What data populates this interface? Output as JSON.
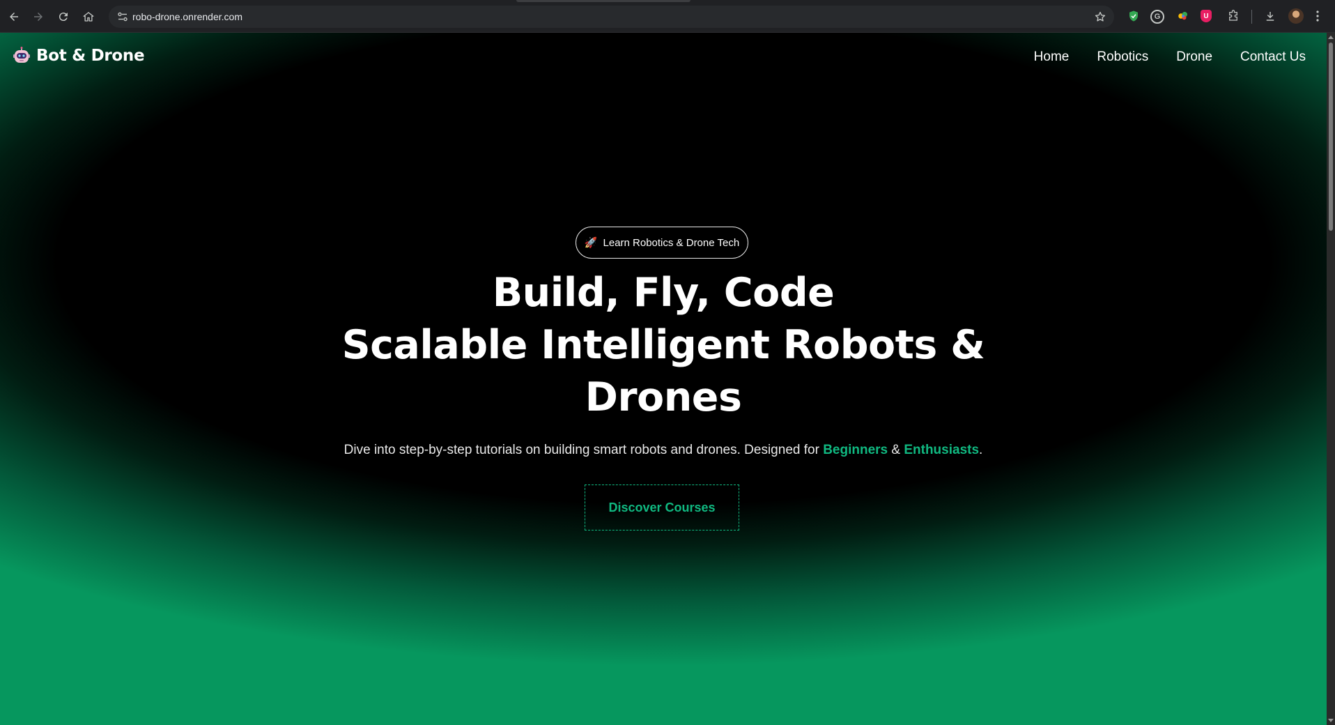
{
  "browser": {
    "url": "robo-drone.onrender.com",
    "nav": {
      "back_icon": "arrow-left-icon",
      "forward_icon": "arrow-right-icon",
      "reload_icon": "reload-icon",
      "home_icon": "home-icon"
    },
    "extensions": [
      "shield-extension-icon",
      "grammarly-extension-icon",
      "colorful-extension-icon",
      "ublock-extension-icon",
      "puzzle-extensions-icon"
    ],
    "ext_ublock_label": "U",
    "ext_grammarly_label": "G"
  },
  "site": {
    "brand": {
      "name": "Bot & Drone",
      "logo_icon": "robot-icon"
    },
    "nav": [
      {
        "label": "Home"
      },
      {
        "label": "Robotics"
      },
      {
        "label": "Drone"
      },
      {
        "label": "Contact Us"
      }
    ],
    "hero": {
      "pill": {
        "emoji": "🚀",
        "label": "Learn Robotics & Drone Tech"
      },
      "headline": [
        "Build, Fly, Code",
        "Scalable Intelligent Robots &",
        "Drones"
      ],
      "subtitle_prefix": "Dive into step-by-step tutorials on building smart robots and drones. Designed for ",
      "subtitle_accent_1": "Beginners",
      "subtitle_mid": " & ",
      "subtitle_accent_2": "Enthusiasts",
      "subtitle_suffix": ".",
      "cta_label": "Discover Courses"
    }
  },
  "colors": {
    "accent": "#10b981",
    "gradient_bottom": "#06975e",
    "background": "#000000"
  }
}
